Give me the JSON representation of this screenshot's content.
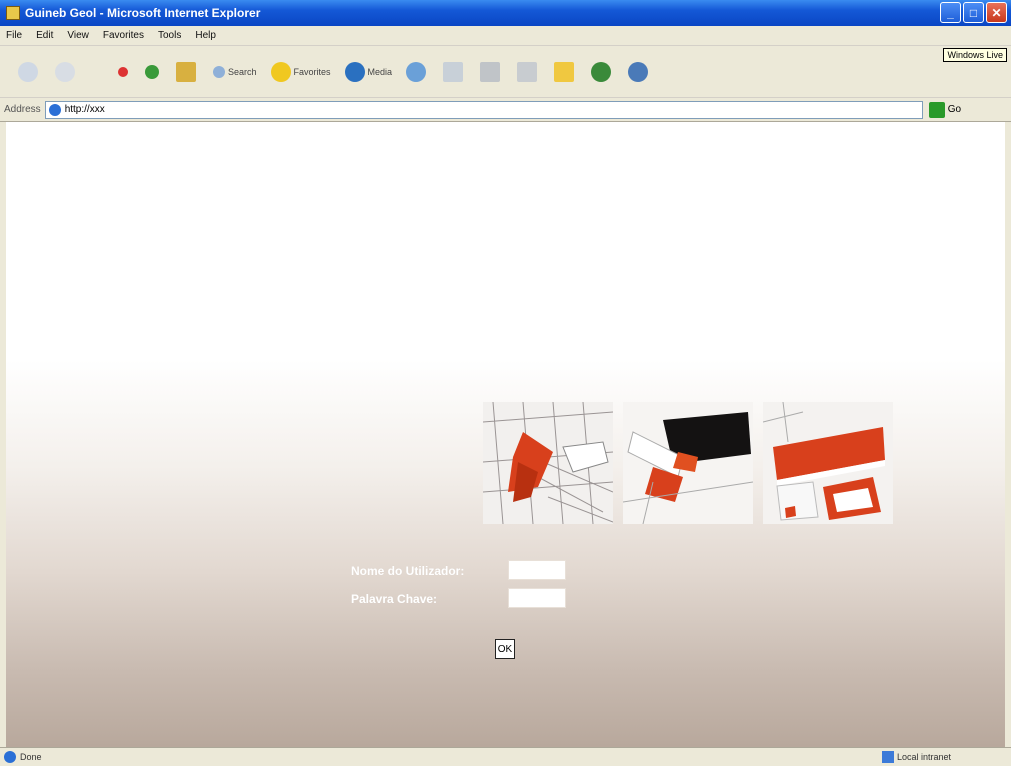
{
  "window": {
    "title": "Guineb Geol - Microsoft Internet Explorer"
  },
  "menu": {
    "items": [
      "File",
      "Edit",
      "View",
      "Favorites",
      "Tools",
      "Help"
    ]
  },
  "tooltip": "Windows Live",
  "toolbar": {
    "search_label": "Search",
    "favorites_label": "Favorites",
    "media_label": "Media"
  },
  "address": {
    "label": "Address",
    "value": "http://xxx",
    "go_label": "Go"
  },
  "login": {
    "username_label": "Nome do Utilizador:",
    "password_label": "Palavra Chave:",
    "ok_label": "OK"
  },
  "status": {
    "text": "Done",
    "zone": "Local intranet"
  },
  "colors": {
    "titlebar": "#0a46c4",
    "photo_accent": "#d8401c"
  }
}
